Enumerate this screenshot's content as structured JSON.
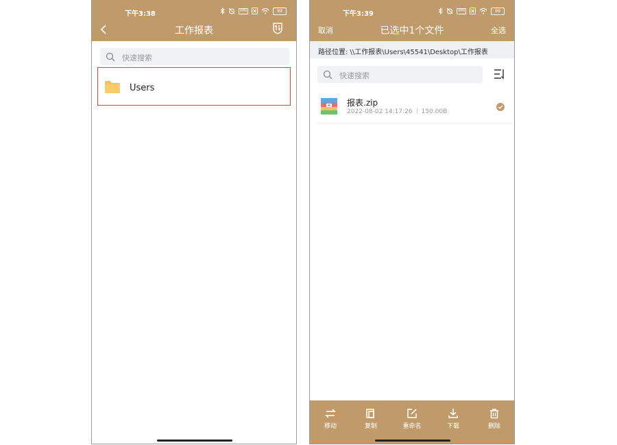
{
  "left_screen": {
    "status_time": "下午3:38",
    "title": "工作报表",
    "search_placeholder": "快速搜索",
    "items": [
      {
        "name": "Users",
        "type": "folder-icon"
      }
    ]
  },
  "right_screen": {
    "status_time": "下午3:39",
    "cancel_label": "取消",
    "title": "已选中1个文件",
    "select_all_label": "全选",
    "path": "路径位置: \\\\工作报表\\Users\\45541\\Desktop\\工作报表",
    "search_placeholder": "快速搜索",
    "files": [
      {
        "name": "报表.zip",
        "date": "2022-08-02 14:17:26",
        "size": "150.00B",
        "selected": true
      }
    ],
    "bottom_actions": [
      {
        "label": "移动",
        "icon": "move-icon"
      },
      {
        "label": "复制",
        "icon": "copy-icon"
      },
      {
        "label": "重命名",
        "icon": "rename-icon"
      },
      {
        "label": "下载",
        "icon": "download-icon"
      },
      {
        "label": "删除",
        "icon": "delete-icon"
      }
    ]
  },
  "status": {
    "battery": "99",
    "vpn": "VPN"
  },
  "colors": {
    "accent": "#bf9b6b",
    "highlight_border": "#d9453b",
    "search_bg": "#f1f2f4",
    "path_bg": "#eef0f3"
  }
}
